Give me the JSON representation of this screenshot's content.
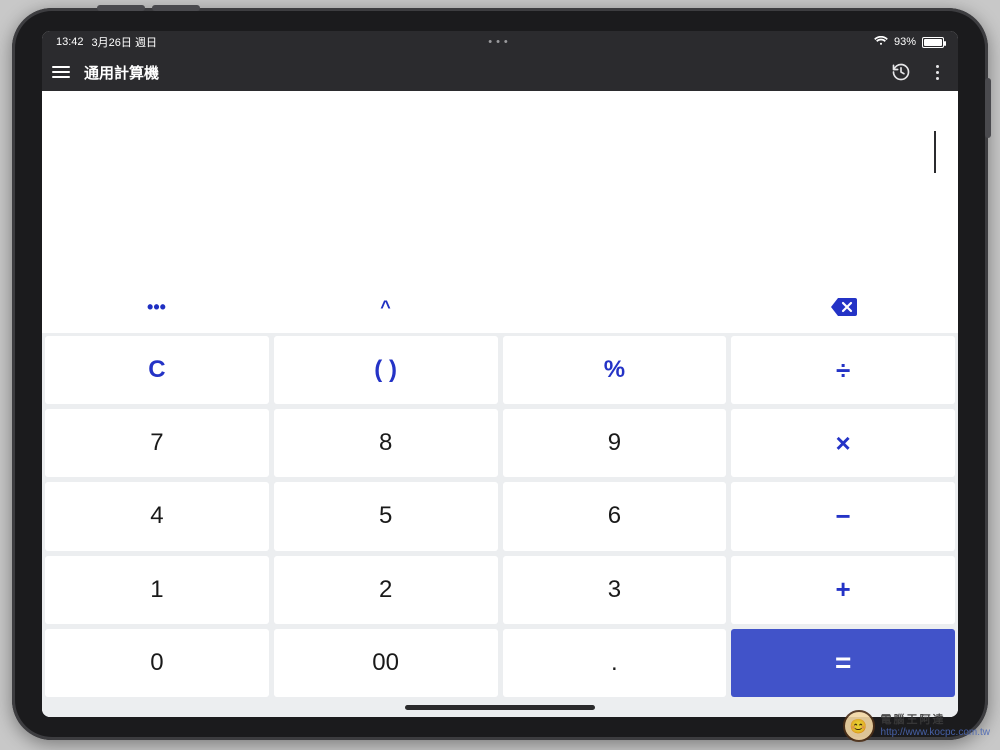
{
  "status": {
    "time": "13:42",
    "date": "3月26日 週日",
    "pill": "•••",
    "battery_pct": "93%"
  },
  "appbar": {
    "title": "通用計算機"
  },
  "funcstrip": {
    "more": "•••",
    "power": "^"
  },
  "keys": {
    "clear": "C",
    "paren": "( )",
    "percent": "%",
    "divide": "÷",
    "k7": "7",
    "k8": "8",
    "k9": "9",
    "multiply": "×",
    "k4": "4",
    "k5": "5",
    "k6": "6",
    "minus": "−",
    "k1": "1",
    "k2": "2",
    "k3": "3",
    "plus": "+",
    "k0": "0",
    "k00": "00",
    "dot": ".",
    "equals": "="
  },
  "watermark": {
    "line1": "電腦王阿達",
    "line2": "http://www.kocpc.com.tw"
  }
}
